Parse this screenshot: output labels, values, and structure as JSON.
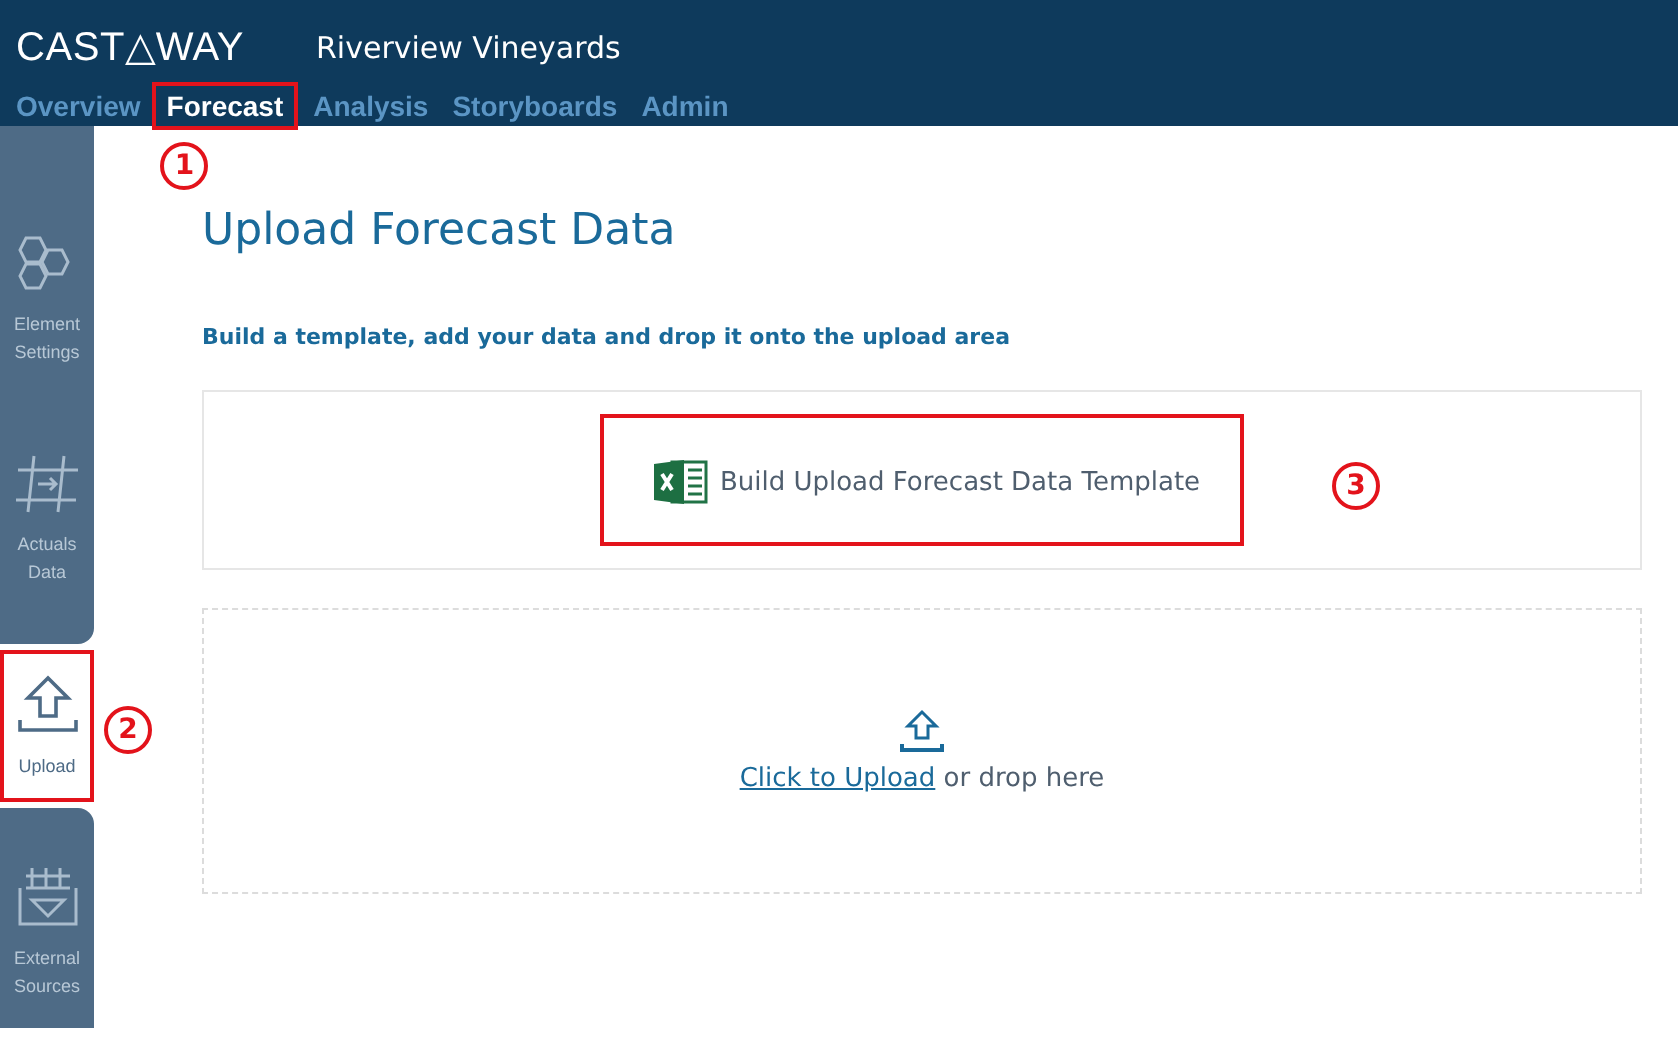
{
  "header": {
    "logo": "CAST△WAY",
    "title": "Riverview Vineyards"
  },
  "nav": [
    {
      "label": "Overview",
      "selected": false
    },
    {
      "label": "Forecast",
      "selected": true,
      "marker": "1"
    },
    {
      "label": "Analysis",
      "selected": false
    },
    {
      "label": "Storyboards",
      "selected": false
    },
    {
      "label": "Admin",
      "selected": false
    }
  ],
  "sidebar": [
    {
      "kind": "settings",
      "lines": [
        "Element",
        "Settings"
      ],
      "selected": false
    },
    {
      "kind": "actuals",
      "lines": [
        "Actuals",
        "Data"
      ],
      "selected": false
    },
    {
      "kind": "upload",
      "lines": [
        "Upload"
      ],
      "selected": true,
      "marker": "2"
    },
    {
      "kind": "external",
      "lines": [
        "External",
        "Sources"
      ],
      "selected": false
    }
  ],
  "page": {
    "title": "Upload Forecast Data",
    "instruction": "Build a template, add your data and drop it onto the upload area",
    "template_button": {
      "label": "Build Upload Forecast Data Template",
      "marker": "3"
    },
    "dropzone": {
      "link": "Click to Upload",
      "text": "or drop here"
    }
  }
}
